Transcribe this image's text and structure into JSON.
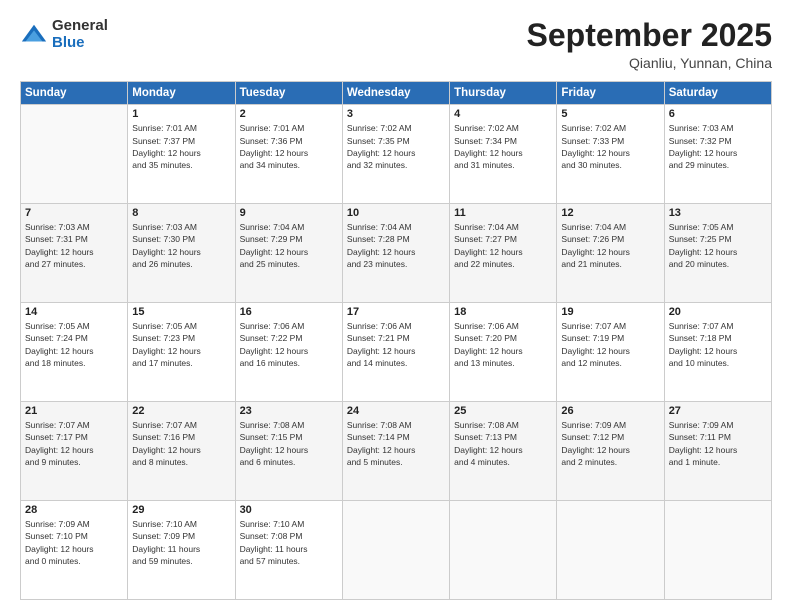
{
  "logo": {
    "general": "General",
    "blue": "Blue"
  },
  "header": {
    "month": "September 2025",
    "location": "Qianliu, Yunnan, China"
  },
  "weekdays": [
    "Sunday",
    "Monday",
    "Tuesday",
    "Wednesday",
    "Thursday",
    "Friday",
    "Saturday"
  ],
  "weeks": [
    [
      {
        "day": "",
        "info": ""
      },
      {
        "day": "1",
        "info": "Sunrise: 7:01 AM\nSunset: 7:37 PM\nDaylight: 12 hours\nand 35 minutes."
      },
      {
        "day": "2",
        "info": "Sunrise: 7:01 AM\nSunset: 7:36 PM\nDaylight: 12 hours\nand 34 minutes."
      },
      {
        "day": "3",
        "info": "Sunrise: 7:02 AM\nSunset: 7:35 PM\nDaylight: 12 hours\nand 32 minutes."
      },
      {
        "day": "4",
        "info": "Sunrise: 7:02 AM\nSunset: 7:34 PM\nDaylight: 12 hours\nand 31 minutes."
      },
      {
        "day": "5",
        "info": "Sunrise: 7:02 AM\nSunset: 7:33 PM\nDaylight: 12 hours\nand 30 minutes."
      },
      {
        "day": "6",
        "info": "Sunrise: 7:03 AM\nSunset: 7:32 PM\nDaylight: 12 hours\nand 29 minutes."
      }
    ],
    [
      {
        "day": "7",
        "info": "Sunrise: 7:03 AM\nSunset: 7:31 PM\nDaylight: 12 hours\nand 27 minutes."
      },
      {
        "day": "8",
        "info": "Sunrise: 7:03 AM\nSunset: 7:30 PM\nDaylight: 12 hours\nand 26 minutes."
      },
      {
        "day": "9",
        "info": "Sunrise: 7:04 AM\nSunset: 7:29 PM\nDaylight: 12 hours\nand 25 minutes."
      },
      {
        "day": "10",
        "info": "Sunrise: 7:04 AM\nSunset: 7:28 PM\nDaylight: 12 hours\nand 23 minutes."
      },
      {
        "day": "11",
        "info": "Sunrise: 7:04 AM\nSunset: 7:27 PM\nDaylight: 12 hours\nand 22 minutes."
      },
      {
        "day": "12",
        "info": "Sunrise: 7:04 AM\nSunset: 7:26 PM\nDaylight: 12 hours\nand 21 minutes."
      },
      {
        "day": "13",
        "info": "Sunrise: 7:05 AM\nSunset: 7:25 PM\nDaylight: 12 hours\nand 20 minutes."
      }
    ],
    [
      {
        "day": "14",
        "info": "Sunrise: 7:05 AM\nSunset: 7:24 PM\nDaylight: 12 hours\nand 18 minutes."
      },
      {
        "day": "15",
        "info": "Sunrise: 7:05 AM\nSunset: 7:23 PM\nDaylight: 12 hours\nand 17 minutes."
      },
      {
        "day": "16",
        "info": "Sunrise: 7:06 AM\nSunset: 7:22 PM\nDaylight: 12 hours\nand 16 minutes."
      },
      {
        "day": "17",
        "info": "Sunrise: 7:06 AM\nSunset: 7:21 PM\nDaylight: 12 hours\nand 14 minutes."
      },
      {
        "day": "18",
        "info": "Sunrise: 7:06 AM\nSunset: 7:20 PM\nDaylight: 12 hours\nand 13 minutes."
      },
      {
        "day": "19",
        "info": "Sunrise: 7:07 AM\nSunset: 7:19 PM\nDaylight: 12 hours\nand 12 minutes."
      },
      {
        "day": "20",
        "info": "Sunrise: 7:07 AM\nSunset: 7:18 PM\nDaylight: 12 hours\nand 10 minutes."
      }
    ],
    [
      {
        "day": "21",
        "info": "Sunrise: 7:07 AM\nSunset: 7:17 PM\nDaylight: 12 hours\nand 9 minutes."
      },
      {
        "day": "22",
        "info": "Sunrise: 7:07 AM\nSunset: 7:16 PM\nDaylight: 12 hours\nand 8 minutes."
      },
      {
        "day": "23",
        "info": "Sunrise: 7:08 AM\nSunset: 7:15 PM\nDaylight: 12 hours\nand 6 minutes."
      },
      {
        "day": "24",
        "info": "Sunrise: 7:08 AM\nSunset: 7:14 PM\nDaylight: 12 hours\nand 5 minutes."
      },
      {
        "day": "25",
        "info": "Sunrise: 7:08 AM\nSunset: 7:13 PM\nDaylight: 12 hours\nand 4 minutes."
      },
      {
        "day": "26",
        "info": "Sunrise: 7:09 AM\nSunset: 7:12 PM\nDaylight: 12 hours\nand 2 minutes."
      },
      {
        "day": "27",
        "info": "Sunrise: 7:09 AM\nSunset: 7:11 PM\nDaylight: 12 hours\nand 1 minute."
      }
    ],
    [
      {
        "day": "28",
        "info": "Sunrise: 7:09 AM\nSunset: 7:10 PM\nDaylight: 12 hours\nand 0 minutes."
      },
      {
        "day": "29",
        "info": "Sunrise: 7:10 AM\nSunset: 7:09 PM\nDaylight: 11 hours\nand 59 minutes."
      },
      {
        "day": "30",
        "info": "Sunrise: 7:10 AM\nSunset: 7:08 PM\nDaylight: 11 hours\nand 57 minutes."
      },
      {
        "day": "",
        "info": ""
      },
      {
        "day": "",
        "info": ""
      },
      {
        "day": "",
        "info": ""
      },
      {
        "day": "",
        "info": ""
      }
    ]
  ]
}
